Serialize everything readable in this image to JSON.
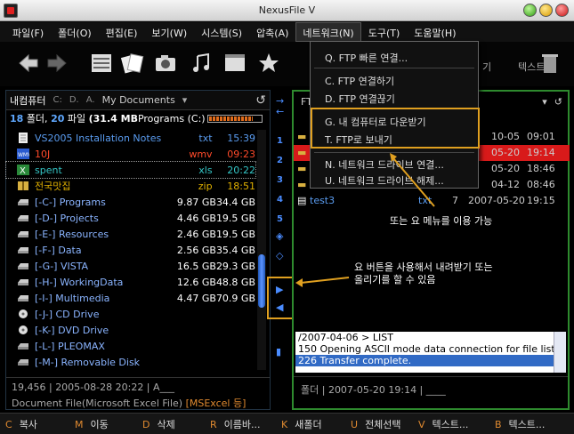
{
  "window": {
    "title": "NexusFile V"
  },
  "menu": [
    "파일(F)",
    "폴더(O)",
    "편집(E)",
    "보기(W)",
    "시스템(S)",
    "압축(A)",
    "네트워크(N)",
    "도구(T)",
    "도움말(H)"
  ],
  "toolbar": {
    "text_left": "기",
    "text_right": "텍스트"
  },
  "left_panel": {
    "path_label": "내컴퓨터",
    "drive_c": "C:",
    "drive_d": "D.",
    "drive_a": "A.",
    "location": "My Documents",
    "stat_folders": "18",
    "stat_folders_label": "폴더,",
    "stat_files": "20",
    "stat_files_label": "파일",
    "stat_size": "(31.4 MB",
    "stat_drive": "Programs (C:)",
    "progress": 0.85,
    "rows": [
      {
        "name": "VS2005 Installation Notes",
        "c1": "txt",
        "c2": "15:39",
        "color": "c-blue",
        "icon": "text-file-icon"
      },
      {
        "name": "10J",
        "c1": "wmv",
        "c2": "09:23",
        "color": "c-red",
        "icon": "video-file-icon"
      },
      {
        "name": "spent",
        "c1": "xls",
        "c2": "20:22",
        "color": "c-green",
        "icon": "excel-file-icon"
      },
      {
        "name": "전국맛집",
        "c1": "zip",
        "c2": "18:51",
        "color": "c-yellow",
        "icon": "zip-file-icon"
      },
      {
        "name": "[-C-] Programs",
        "c1": "9.87 GB",
        "c2": "34.4 GB",
        "color": "c-drive",
        "icon": "hard-drive-icon"
      },
      {
        "name": "[-D-] Projects",
        "c1": "4.46 GB",
        "c2": "19.5 GB",
        "color": "c-drive",
        "icon": "hard-drive-icon"
      },
      {
        "name": "[-E-] Resources",
        "c1": "2.46 GB",
        "c2": "19.5 GB",
        "color": "c-drive",
        "icon": "hard-drive-icon"
      },
      {
        "name": "[-F-] Data",
        "c1": "2.56 GB",
        "c2": "35.4 GB",
        "color": "c-drive",
        "icon": "hard-drive-icon"
      },
      {
        "name": "[-G-] VISTA",
        "c1": "16.5 GB",
        "c2": "29.3 GB",
        "color": "c-drive",
        "icon": "hard-drive-icon"
      },
      {
        "name": "[-H-] WorkingData",
        "c1": "12.6 GB",
        "c2": "48.8 GB",
        "color": "c-drive",
        "icon": "hard-drive-icon"
      },
      {
        "name": "[-I-] Multimedia",
        "c1": "4.47 GB",
        "c2": "70.9 GB",
        "color": "c-drive",
        "icon": "hard-drive-icon"
      },
      {
        "name": "[-J-] CD Drive",
        "c1": "",
        "c2": "",
        "color": "c-drive",
        "icon": "cd-drive-icon"
      },
      {
        "name": "[-K-] DVD Drive",
        "c1": "",
        "c2": "",
        "color": "c-drive",
        "icon": "cd-drive-icon"
      },
      {
        "name": "[-L-] PLEOMAX",
        "c1": "",
        "c2": "",
        "color": "c-drive",
        "icon": "removable-drive-icon"
      },
      {
        "name": "[-M-] Removable Disk",
        "c1": "",
        "c2": "",
        "color": "c-drive",
        "icon": "removable-drive-icon"
      }
    ],
    "footer_line1": "19,456 | 2005-08-28 20:22 | A___",
    "footer_line2": "Document File(Microsoft Excel File)",
    "footer_line2_hl": "[MSExcel 등]"
  },
  "middle": {
    "numbers": [
      "1",
      "2",
      "3",
      "4",
      "5"
    ]
  },
  "right_panel": {
    "header_label": "FT",
    "rows": [
      {
        "name": "",
        "c1": "",
        "date": "10-05",
        "time": "09:01",
        "red": false
      },
      {
        "name": "",
        "c1": "",
        "date": "05-20",
        "time": "19:14",
        "red": true
      },
      {
        "name": "",
        "c1": "",
        "date": "05-20",
        "time": "18:46",
        "red": false
      },
      {
        "name": "",
        "c1": "",
        "date": "04-12",
        "time": "08:46",
        "red": false
      },
      {
        "name": "test3",
        "c1": "txt",
        "size": "7",
        "date": "2007-05-20",
        "time": "19:15",
        "red": false
      }
    ],
    "log": [
      "/2007-04-06 > LIST",
      "150 Opening ASCII mode data connection for file list",
      "226 Transfer complete."
    ],
    "footer": "폴더 | 2007-05-20 19:14 | ____"
  },
  "dropdown": {
    "items": [
      "Q. FTP 빠른 연결...",
      "C. FTP 연결하기",
      "D. FTP 연결끊기",
      "G. 내 컴퓨터로 다운받기",
      "T. FTP로 보내기",
      "N. 네트워크 드라이브 연결...",
      "U. 네트워크 드라이브 해제..."
    ]
  },
  "annotations": {
    "menu_note": "또는 요 메뉴를 이용 가능",
    "button_note_1": "요 버튼을 사용해서 내려받기 또는",
    "button_note_2": "올리기를 할 수 있음"
  },
  "fbar": [
    {
      "key": "C",
      "label": "복사"
    },
    {
      "key": "M",
      "label": "이동"
    },
    {
      "key": "D",
      "label": "삭제"
    },
    {
      "key": "R",
      "label": "이름바..."
    },
    {
      "key": "K",
      "label": "새폴더"
    },
    {
      "key": "U",
      "label": "전체선택"
    },
    {
      "key": "V",
      "label": "텍스트..."
    },
    {
      "key": "B",
      "label": "텍스트..."
    }
  ],
  "colors": {
    "accent_highlight": "#e0a020",
    "selection_red": "#d81a1a",
    "panel_border_green": "#2e8a2e"
  }
}
